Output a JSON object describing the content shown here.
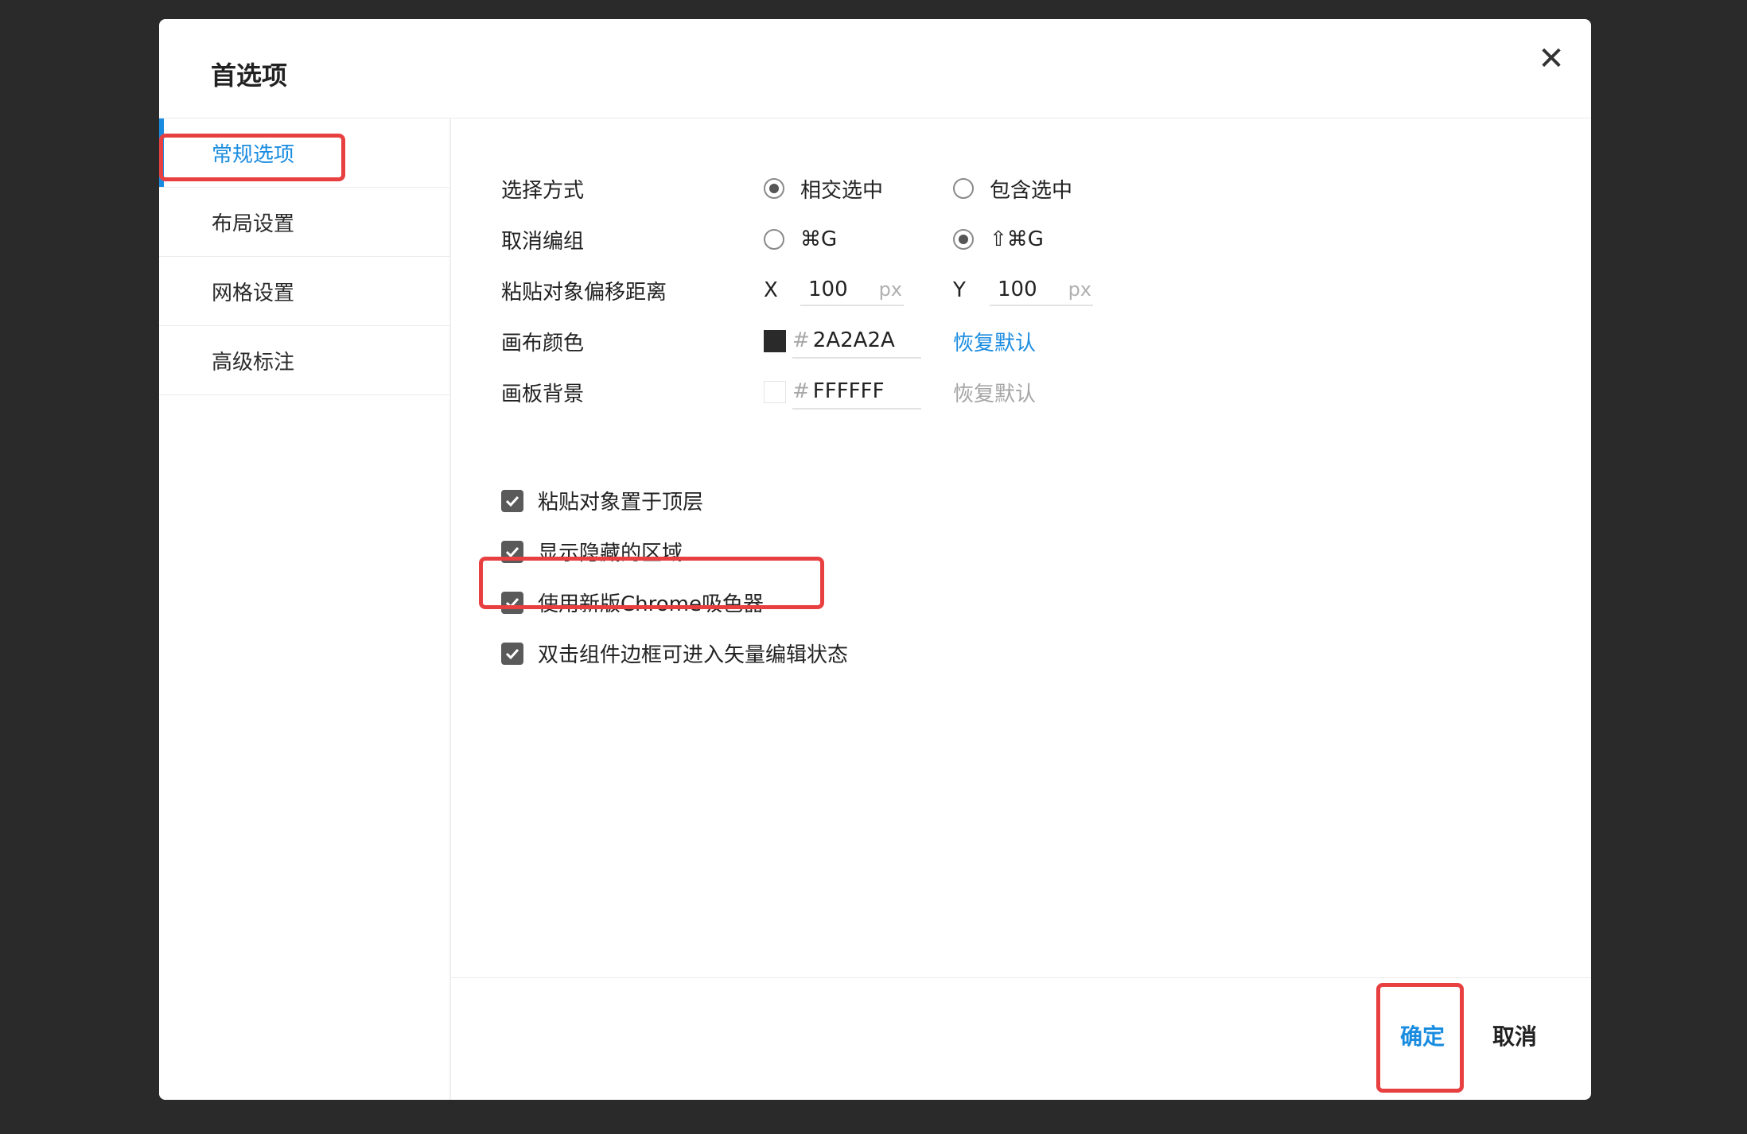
{
  "dialog": {
    "title": "首选项",
    "close_icon": "close-icon"
  },
  "sidebar": {
    "items": [
      {
        "label": "常规选项",
        "active": true
      },
      {
        "label": "布局设置",
        "active": false
      },
      {
        "label": "网格设置",
        "active": false
      },
      {
        "label": "高级标注",
        "active": false
      }
    ]
  },
  "general": {
    "selection_mode": {
      "label": "选择方式",
      "options": [
        "相交选中",
        "包含选中"
      ],
      "selected": "相交选中"
    },
    "ungroup": {
      "label": "取消编组",
      "options": [
        "⌘G",
        "⇧⌘G"
      ],
      "selected": "⇧⌘G"
    },
    "paste_offset": {
      "label": "粘贴对象偏移距离",
      "x_label": "X",
      "x_value": "100",
      "y_label": "Y",
      "y_value": "100",
      "unit": "px"
    },
    "canvas_color": {
      "label": "画布颜色",
      "hash": "#",
      "value": "2A2A2A",
      "swatch": "#2a2a2a",
      "reset": "恢复默认"
    },
    "artboard_bg": {
      "label": "画板背景",
      "hash": "#",
      "value": "FFFFFF",
      "swatch": "#ffffff",
      "reset": "恢复默认"
    },
    "checkboxes": [
      {
        "label": "粘贴对象置于顶层",
        "checked": true
      },
      {
        "label": "显示隐藏的区域",
        "checked": true
      },
      {
        "label": "使用新版Chrome吸色器",
        "checked": true
      },
      {
        "label": "双击组件边框可进入矢量编辑状态",
        "checked": true
      }
    ]
  },
  "footer": {
    "ok_label": "确定",
    "cancel_label": "取消"
  },
  "colors": {
    "accent": "#1a8ce0",
    "highlight": "#e84040",
    "backdrop": "#2a2a2a"
  }
}
